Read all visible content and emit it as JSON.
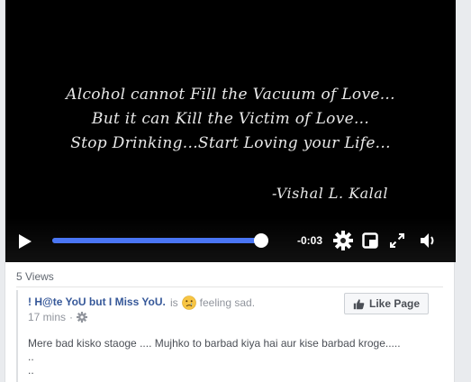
{
  "video": {
    "quote_lines": [
      "Alcohol cannot Fill the Vacuum of Love...",
      "But it can Kill the Victim of Love...",
      "Stop Drinking...Start Loving your Life..."
    ],
    "author": "-Vishal L. Kalal",
    "time_remaining": "-0:03",
    "progress_fraction": 0.99,
    "accent_color": "#4a76f5"
  },
  "post": {
    "views": "5 Views",
    "page_name": "! H@te YoU but I Miss YoU.",
    "is_text": "is",
    "feeling": "feeling sad.",
    "time_ago": "17 mins",
    "meta_separator": "·",
    "like_button": "Like Page",
    "status_lines": [
      "Mere bad kisko staoge .... Mujhko to barbad kiya hai aur kise barbad kroge.....",
      "..",
      ".."
    ],
    "link_color": "#365899"
  },
  "icons": {
    "play": "play-icon",
    "settings": "gear-icon",
    "pip": "picture-in-picture-icon",
    "fullscreen": "fullscreen-icon",
    "volume": "volume-icon",
    "audience": "gear-icon",
    "like": "thumbs-up-icon",
    "emoji": "sad-face-icon"
  }
}
